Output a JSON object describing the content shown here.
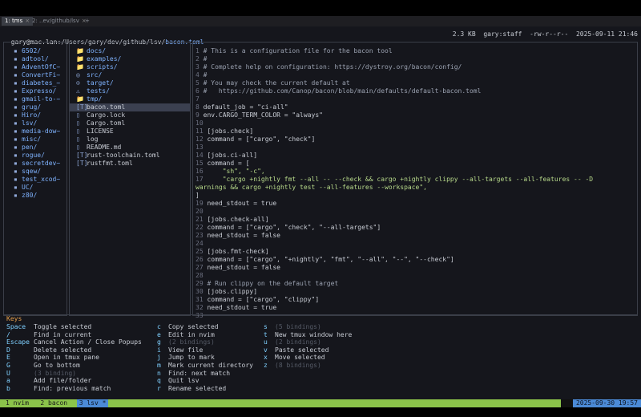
{
  "tabs": [
    {
      "label": "1: tms",
      "close": "×",
      "active": true
    },
    {
      "label": "2: ..ev/github/lsv",
      "close": "×",
      "active": false
    },
    {
      "label": "+",
      "close": "",
      "active": false
    }
  ],
  "header": {
    "user_host": "gary@mac.lan",
    "path": ":/Users/gary/dev/github/lsv/",
    "file": "bacon.toml",
    "size": "2.3 KB",
    "owner": "gary:staff",
    "perms": "-rw-r--r--",
    "datetime": "2025-09-11 21:46"
  },
  "left_pane": [
    "6502/",
    "adtool/",
    "AdventOfC~",
    "ConvertFi~",
    "diabetes_~",
    "Expresso/",
    "gmail-to-~",
    "grug/",
    "Hiro/",
    "lsv/",
    "media-dow~",
    "misc/",
    "pen/",
    "rogue/",
    "secretdev~",
    "sqew/",
    "test_xcod~",
    "UC/",
    "z80/"
  ],
  "mid_pane": [
    {
      "icon": "📁",
      "label": "docs/",
      "dir": true
    },
    {
      "icon": "📁",
      "label": "examples/",
      "dir": true
    },
    {
      "icon": "📁",
      "label": "scripts/",
      "dir": true
    },
    {
      "icon": "◎",
      "label": "src/",
      "dir": true
    },
    {
      "icon": "⊙",
      "label": "target/",
      "dir": true
    },
    {
      "icon": "⚠",
      "label": "tests/",
      "dir": true
    },
    {
      "icon": "📁",
      "label": "tmp/",
      "dir": true
    },
    {
      "icon": "[T]",
      "label": "bacon.toml",
      "dir": false,
      "selected": true
    },
    {
      "icon": "▯",
      "label": "Cargo.lock",
      "dir": false
    },
    {
      "icon": "▯",
      "label": "Cargo.toml",
      "dir": false
    },
    {
      "icon": "▯",
      "label": "LICENSE",
      "dir": false
    },
    {
      "icon": "▯",
      "label": "log",
      "dir": false
    },
    {
      "icon": "▯",
      "label": "README.md",
      "dir": false
    },
    {
      "icon": "[T]",
      "label": "rust-toolchain.toml",
      "dir": false
    },
    {
      "icon": "[T]",
      "label": "rustfmt.toml",
      "dir": false
    }
  ],
  "code_lines": [
    {
      "n": "1",
      "t": "# This is a configuration file for the bacon tool",
      "c": "cm"
    },
    {
      "n": "2",
      "t": "#",
      "c": "cm"
    },
    {
      "n": "3",
      "t": "# Complete help on configuration: https://dystroy.org/bacon/config/",
      "c": "cm"
    },
    {
      "n": "4",
      "t": "#",
      "c": "cm"
    },
    {
      "n": "5",
      "t": "# You may check the current default at",
      "c": "cm"
    },
    {
      "n": "6",
      "t": "#   https://github.com/Canop/bacon/blob/main/defaults/default-bacon.toml",
      "c": "cm"
    },
    {
      "n": "7",
      "t": "",
      "c": ""
    },
    {
      "n": "8",
      "t": "default_job = \"ci-all\"",
      "c": ""
    },
    {
      "n": "9",
      "t": "env.CARGO_TERM_COLOR = \"always\"",
      "c": ""
    },
    {
      "n": "10",
      "t": "",
      "c": ""
    },
    {
      "n": "11",
      "t": "[jobs.check]",
      "c": ""
    },
    {
      "n": "12",
      "t": "command = [\"cargo\", \"check\"]",
      "c": ""
    },
    {
      "n": "13",
      "t": "",
      "c": ""
    },
    {
      "n": "14",
      "t": "[jobs.ci-all]",
      "c": ""
    },
    {
      "n": "15",
      "t": "command = [",
      "c": ""
    },
    {
      "n": "16",
      "t": "    \"sh\", \"-c\",",
      "c": "str"
    },
    {
      "n": "17",
      "t": "    \"cargo +nightly fmt --all -- --check && cargo +nightly clippy --all-targets --all-features -- -D",
      "c": "str"
    },
    {
      "n": "",
      "t": "warnings && cargo +nightly test --all-features --workspace\",",
      "c": "str"
    },
    {
      "n": "",
      "t": "]",
      "c": ""
    },
    {
      "n": "19",
      "t": "need_stdout = true",
      "c": ""
    },
    {
      "n": "20",
      "t": "",
      "c": ""
    },
    {
      "n": "21",
      "t": "[jobs.check-all]",
      "c": ""
    },
    {
      "n": "22",
      "t": "command = [\"cargo\", \"check\", \"--all-targets\"]",
      "c": ""
    },
    {
      "n": "23",
      "t": "need_stdout = false",
      "c": ""
    },
    {
      "n": "24",
      "t": "",
      "c": ""
    },
    {
      "n": "25",
      "t": "[jobs.fmt-check]",
      "c": ""
    },
    {
      "n": "26",
      "t": "command = [\"cargo\", \"+nightly\", \"fmt\", \"--all\", \"--\", \"--check\"]",
      "c": ""
    },
    {
      "n": "27",
      "t": "need_stdout = false",
      "c": ""
    },
    {
      "n": "28",
      "t": "",
      "c": ""
    },
    {
      "n": "29",
      "t": "# Run clippy on the default target",
      "c": "cm"
    },
    {
      "n": "30",
      "t": "[jobs.clippy]",
      "c": ""
    },
    {
      "n": "31",
      "t": "command = [\"cargo\", \"clippy\"]",
      "c": ""
    },
    {
      "n": "32",
      "t": "need_stdout = true",
      "c": ""
    },
    {
      "n": "33",
      "t": "",
      "c": ""
    }
  ],
  "keys": {
    "title": "Keys",
    "col1": [
      {
        "k": "Space",
        "d": "Toggle selected",
        "muted": false
      },
      {
        "k": "/",
        "d": "Find in current",
        "muted": false
      },
      {
        "k": "Escape",
        "d": "Cancel Action / Close Popups",
        "muted": false
      },
      {
        "k": "D",
        "d": "Delete selected",
        "muted": false
      },
      {
        "k": "E",
        "d": "Open in tmux pane",
        "muted": false
      },
      {
        "k": "G",
        "d": "Go to bottom",
        "muted": false
      },
      {
        "k": "U",
        "d": "(3 binding)",
        "muted": true
      },
      {
        "k": "a",
        "d": "Add file/folder",
        "muted": false
      },
      {
        "k": "b",
        "d": "Find: previous match",
        "muted": false
      }
    ],
    "col2": [
      {
        "k": "c",
        "d": "Copy selected",
        "muted": false
      },
      {
        "k": "e",
        "d": "Edit in nvim",
        "muted": false
      },
      {
        "k": "g",
        "d": "(2 bindings)",
        "muted": true
      },
      {
        "k": "i",
        "d": "View file",
        "muted": false
      },
      {
        "k": "j",
        "d": "Jump to mark",
        "muted": false
      },
      {
        "k": "m",
        "d": "Mark current directory",
        "muted": false
      },
      {
        "k": "n",
        "d": "Find: next match",
        "muted": false
      },
      {
        "k": "q",
        "d": "Quit lsv",
        "muted": false
      },
      {
        "k": "r",
        "d": "Rename selected",
        "muted": false
      }
    ],
    "col3": [
      {
        "k": "s",
        "d": "(5 bindings)",
        "muted": true
      },
      {
        "k": "t",
        "d": "New tmux window here",
        "muted": false
      },
      {
        "k": "u",
        "d": "(2 bindings)",
        "muted": true
      },
      {
        "k": "v",
        "d": "Paste selected",
        "muted": false
      },
      {
        "k": "x",
        "d": "Move selected",
        "muted": false
      },
      {
        "k": "z",
        "d": "(8 bindings)",
        "muted": true
      }
    ]
  },
  "statusbar": {
    "windows": [
      "1 nvim",
      "2 bacon",
      "3 lsv *"
    ],
    "active_index": 2,
    "datetime": "2025-09-30 19:57"
  }
}
